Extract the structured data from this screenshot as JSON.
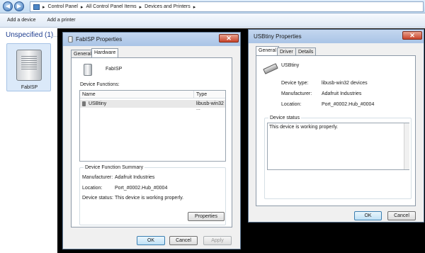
{
  "explorer": {
    "breadcrumb": [
      "Control Panel",
      "All Control Panel Items",
      "Devices and Printers"
    ],
    "toolbar": [
      "Add a device",
      "Add a printer"
    ],
    "group_label": "Unspecified (1)",
    "device_name": "FabISP"
  },
  "fab": {
    "title": "FabISP Properties",
    "tabs": [
      "General",
      "Hardware"
    ],
    "device_name": "FabISP",
    "device_functions_label": "Device Functions:",
    "columns": [
      "Name",
      "Type"
    ],
    "rows": [
      {
        "name": "USBtiny",
        "type": "libusb-win32 ..."
      }
    ],
    "summary_title": "Device Function Summary",
    "summary": [
      {
        "label": "Manufacturer:",
        "value": "Adafruit Industries"
      },
      {
        "label": "Location:",
        "value": "Port_#0002.Hub_#0004"
      },
      {
        "label": "Device status:",
        "value": "This device is working properly."
      }
    ],
    "properties_btn": "Properties",
    "buttons": [
      "OK",
      "Cancel",
      "Apply"
    ]
  },
  "usb": {
    "title": "USBtiny Properties",
    "tabs": [
      "General",
      "Driver",
      "Details"
    ],
    "device_name": "USBtiny",
    "fields": [
      {
        "label": "Device type:",
        "value": "libusb-win32 devices"
      },
      {
        "label": "Manufacturer:",
        "value": "Adafruit Industries"
      },
      {
        "label": "Location:",
        "value": "Port_#0002.Hub_#0004"
      }
    ],
    "status_title": "Device status",
    "status_text": "This device is working properly.",
    "buttons": [
      "OK",
      "Cancel"
    ]
  }
}
